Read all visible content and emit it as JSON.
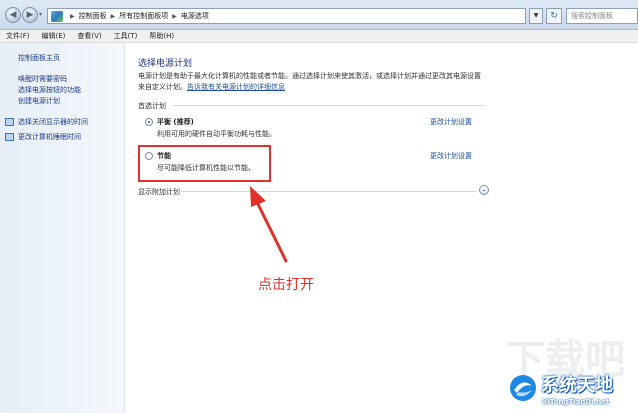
{
  "address_bar": {
    "breadcrumbs": [
      "控制面板",
      "所有控制面板项",
      "电源选项"
    ],
    "search_placeholder": "搜索控制面板"
  },
  "menu": [
    "文件(F)",
    "编辑(E)",
    "查看(V)",
    "工具(T)",
    "帮助(H)"
  ],
  "left_pane": {
    "home": "控制面板主页",
    "items": [
      "唤醒时需要密码",
      "选择电源按钮的功能",
      "创建电源计划"
    ],
    "icon_items": [
      "选择关闭显示器的时间",
      "更改计算机睡眠时间"
    ]
  },
  "main": {
    "title": "选择电源计划",
    "description_line1": "电源计划是有助于最大化计算机的性能或者节能。通过选择计划来使其激活，或选择计划并通过更改其电源设置",
    "description_line2_prefix": "来自定义计划。",
    "description_link": "告诉我有关电源计划的详细信息",
    "preferred_label": "首选计划",
    "plans": [
      {
        "name": "平衡 (推荐)",
        "desc": "利用可用的硬件自动平衡功耗与性能。",
        "selected": true,
        "link": "更改计划设置"
      },
      {
        "name": "节能",
        "desc": "尽可能降低计算机性能以节能。",
        "selected": false,
        "link": "更改计划设置"
      }
    ],
    "more_plans_label": "显示附加计划",
    "annotation": "点击打开",
    "annotation_color": "#e0322a"
  },
  "watermark": {
    "name": "系统天地",
    "url": "XiTongTianDi.net"
  }
}
